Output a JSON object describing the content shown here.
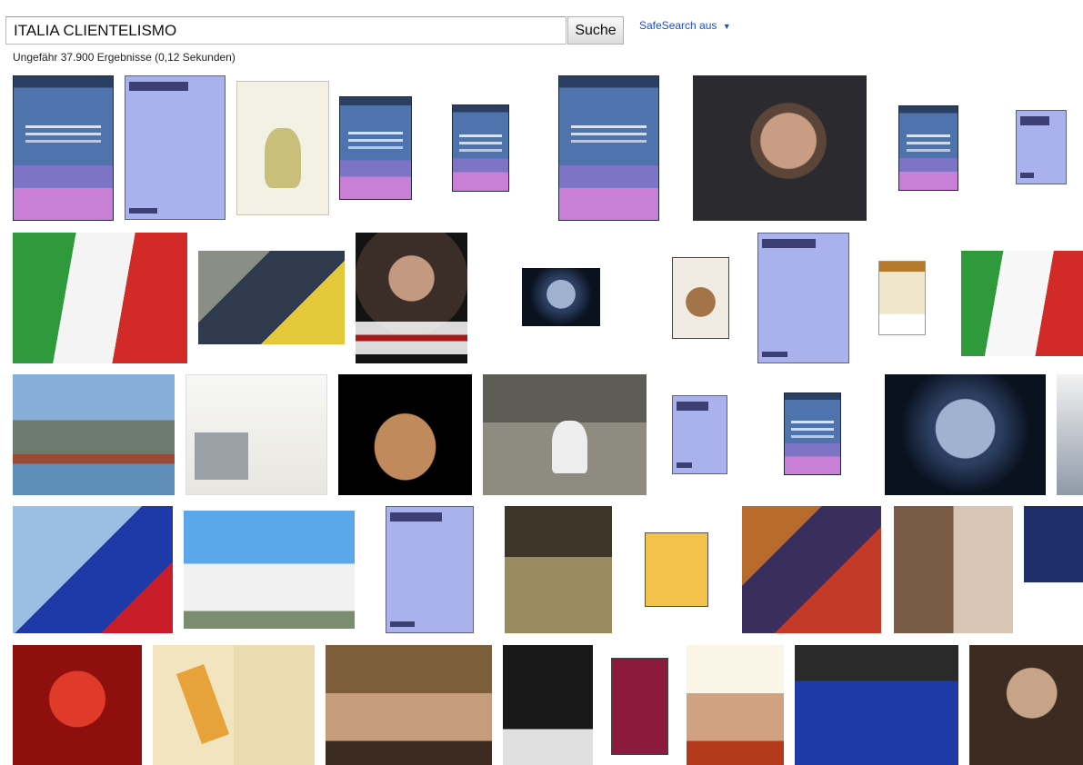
{
  "search": {
    "query": "ITALIA CLIENTELISMO",
    "button_label": "Suche"
  },
  "safesearch": {
    "label": "SafeSearch aus",
    "arrow": "▼"
  },
  "results": {
    "stats": "Ungefähr 37.900 Ergebnisse (0,12 Sekunden)"
  }
}
